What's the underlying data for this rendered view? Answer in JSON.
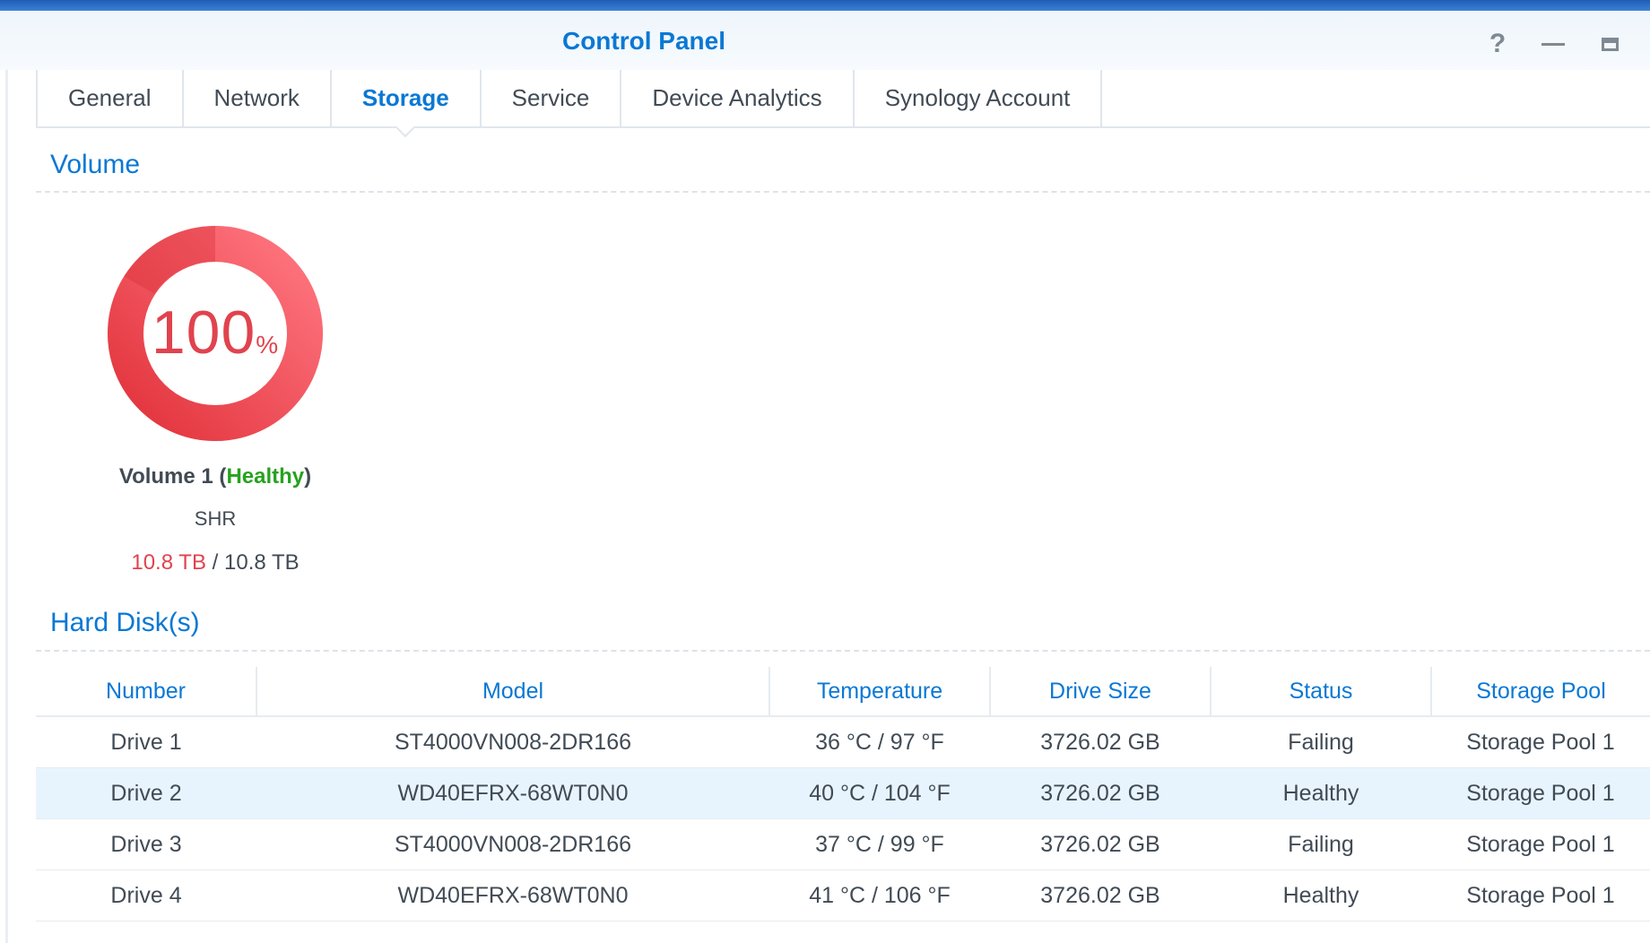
{
  "window": {
    "title": "Control Panel",
    "controls": {
      "help_icon": "help-icon",
      "minimize_icon": "minimize-icon",
      "maximize_icon": "maximize-icon"
    }
  },
  "tabs": [
    {
      "label": "General",
      "active": false
    },
    {
      "label": "Network",
      "active": false
    },
    {
      "label": "Storage",
      "active": true
    },
    {
      "label": "Service",
      "active": false
    },
    {
      "label": "Device Analytics",
      "active": false
    },
    {
      "label": "Synology Account",
      "active": false
    }
  ],
  "volume_section": {
    "title": "Volume",
    "volume": {
      "usage_value": "100",
      "usage_unit": "%",
      "usage_fraction": 1.0,
      "name": "Volume 1",
      "status": "Healthy",
      "raid_type": "SHR",
      "used": "10.8 TB",
      "separator": " / ",
      "total": "10.8 TB"
    }
  },
  "disks_section": {
    "title": "Hard Disk(s)",
    "columns": [
      "Number",
      "Model",
      "Temperature",
      "Drive Size",
      "Status",
      "Storage Pool"
    ],
    "rows": [
      {
        "number": "Drive 1",
        "model": "ST4000VN008-2DR166",
        "temperature": "36 °C / 97 °F",
        "size": "3726.02 GB",
        "status": "Failing",
        "pool": "Storage Pool 1"
      },
      {
        "number": "Drive 2",
        "model": "WD40EFRX-68WT0N0",
        "temperature": "40 °C / 104 °F",
        "size": "3726.02 GB",
        "status": "Healthy",
        "pool": "Storage Pool 1"
      },
      {
        "number": "Drive 3",
        "model": "ST4000VN008-2DR166",
        "temperature": "37 °C / 99 °F",
        "size": "3726.02 GB",
        "status": "Failing",
        "pool": "Storage Pool 1"
      },
      {
        "number": "Drive 4",
        "model": "WD40EFRX-68WT0N0",
        "temperature": "41 °C / 106 °F",
        "size": "3726.02 GB",
        "status": "Healthy",
        "pool": "Storage Pool 1"
      }
    ],
    "selected_row": 1
  },
  "colors": {
    "accent": "#0a78d4",
    "failing": "#e0434e",
    "healthy": "#27a21f",
    "donut_dark": "#e2333c",
    "donut_light": "#ff7680"
  }
}
